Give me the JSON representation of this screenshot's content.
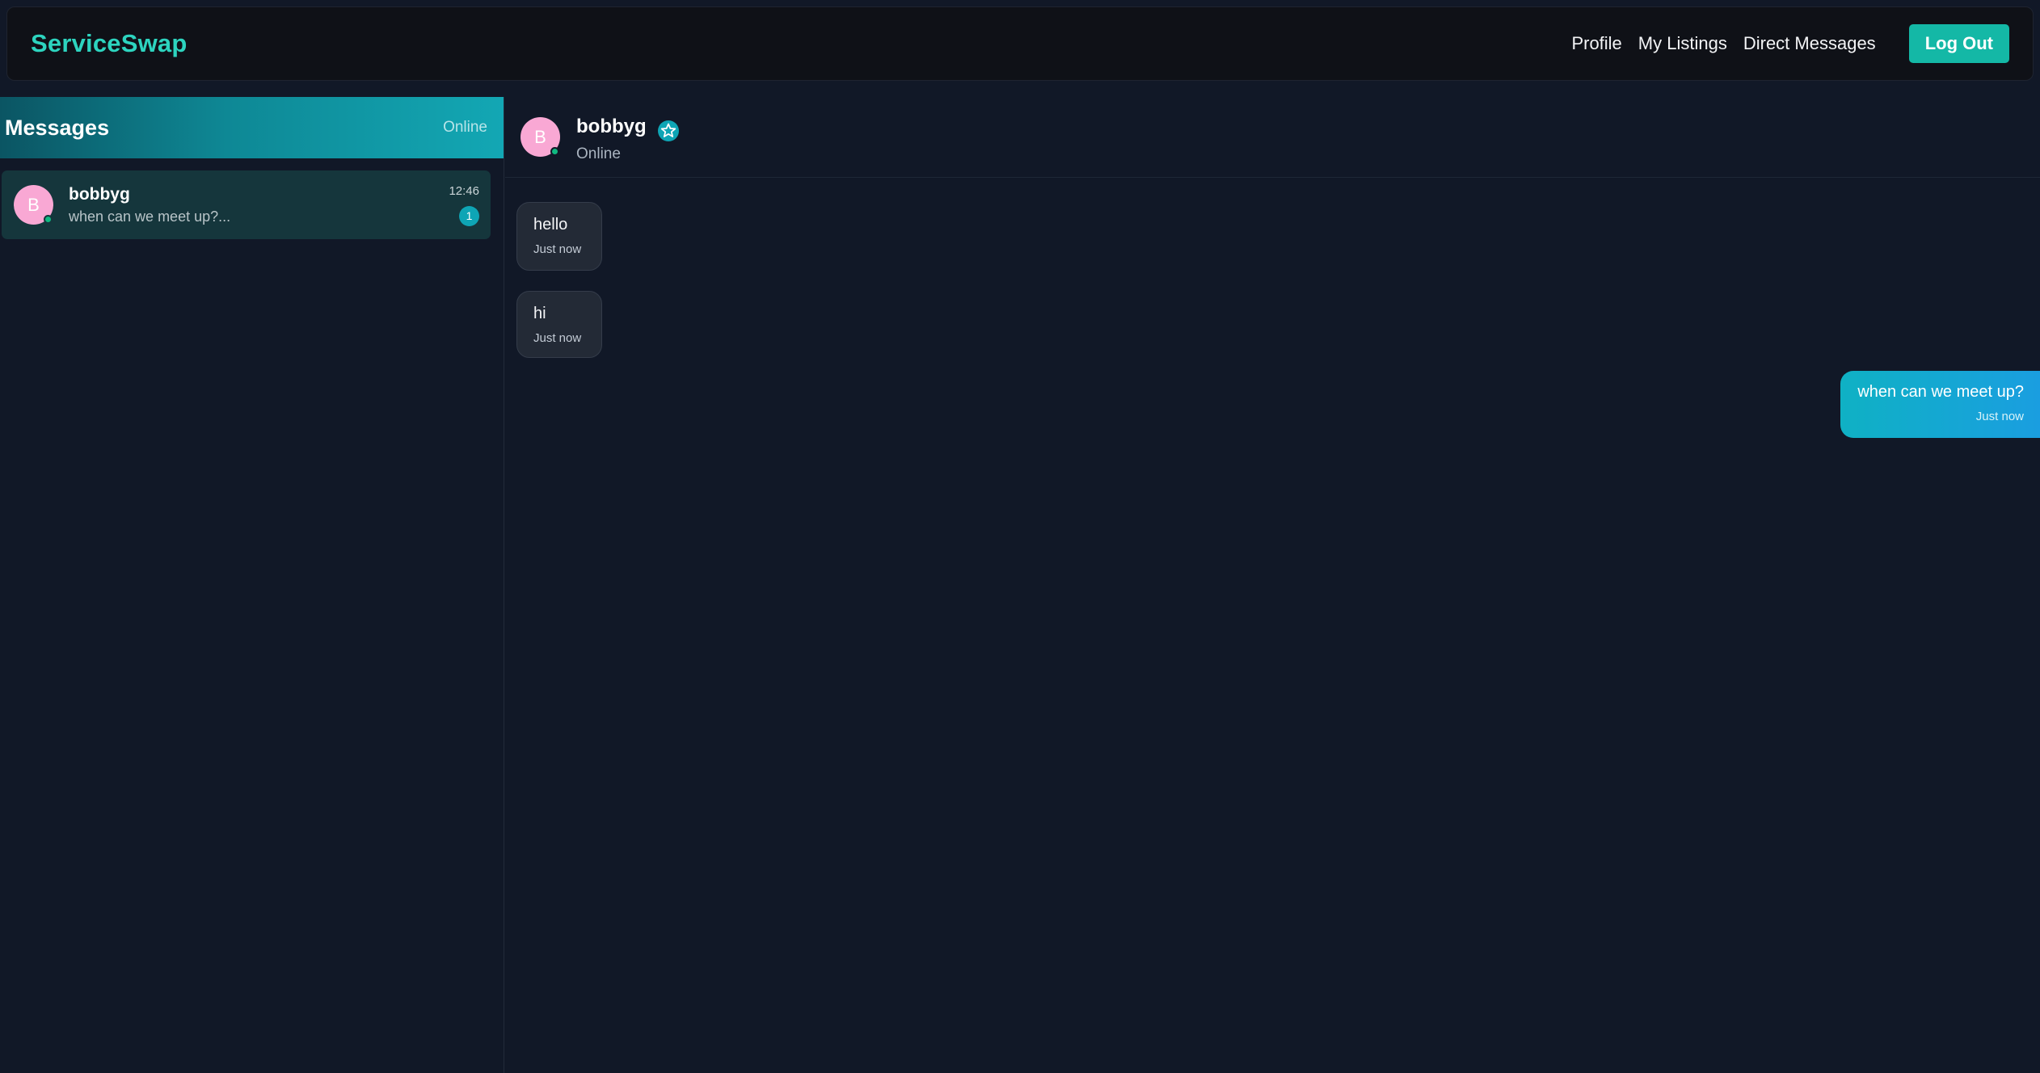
{
  "brand": "ServiceSwap",
  "nav": {
    "profile": "Profile",
    "my_listings": "My Listings",
    "direct_messages": "Direct Messages",
    "logout": "Log Out"
  },
  "sidebar": {
    "title": "Messages",
    "status": "Online",
    "conversations": [
      {
        "avatar_letter": "B",
        "name": "bobbyg",
        "preview": "when can we meet up?...",
        "time": "12:46",
        "unread": "1",
        "online": true
      }
    ]
  },
  "chat": {
    "avatar_letter": "B",
    "name": "bobbyg",
    "status": "Online",
    "verified_icon": "star-badge-icon",
    "messages": [
      {
        "direction": "incoming",
        "text": "hello",
        "time": "Just now"
      },
      {
        "direction": "incoming",
        "text": "hi",
        "time": "Just now"
      },
      {
        "direction": "outgoing",
        "text": "when can we meet up?",
        "time": "Just now"
      }
    ]
  },
  "colors": {
    "accent": "#2dd4bf",
    "button": "#14b8a6",
    "avatar": "#f9a8d4",
    "online": "#10b981",
    "background": "#111827"
  }
}
